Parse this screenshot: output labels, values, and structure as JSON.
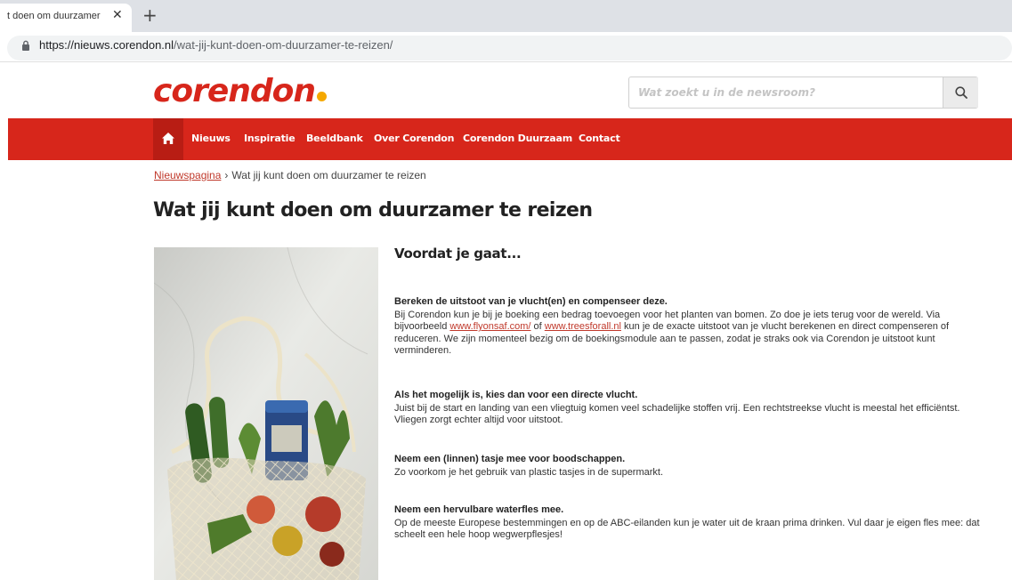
{
  "browser": {
    "tab_title": "t doen om duurzamer",
    "close_symbol": "✕",
    "new_tab_symbol": "+",
    "url_host": "https://nieuws.corendon.nl",
    "url_path": "/wat-jij-kunt-doen-om-duurzamer-te-reizen/"
  },
  "site": {
    "logo_text": "corendon",
    "brand_color": "#d7261b",
    "dot_color": "#f5a800",
    "search_placeholder": "Wat zoekt u in de newsroom?"
  },
  "nav": {
    "items": [
      "Nieuws",
      "Inspiratie",
      "Beeldbank",
      "Over Corendon",
      "Corendon Duurzaam",
      "Contact"
    ]
  },
  "breadcrumb": {
    "home": "Nieuwspagina",
    "separator": "›",
    "current": "Wat jij kunt doen om duurzamer te reizen"
  },
  "page": {
    "title": "Wat jij kunt doen om duurzamer te reizen",
    "section_title": "Voordat je gaat..."
  },
  "article": {
    "b1_heading": "Bereken de uitstoot van je vlucht(en) en compenseer deze.",
    "b1_text1": "Bij Corendon kun je bij je boeking een bedrag toevoegen voor het planten van bomen. Zo doe je iets terug voor de wereld. Via bijvoorbeeld ",
    "b1_link1": "www.flyonsaf.com/",
    "b1_text2": " of ",
    "b1_link2": "www.treesforall.nl",
    "b1_text3": " kun je de exacte uitstoot van je vlucht berekenen en direct compenseren of reduceren. We zijn momenteel bezig om de boekingsmodule aan te passen, zodat je straks ook via Corendon je uitstoot kunt verminderen.",
    "b2_heading": "Als het mogelijk is, kies dan voor een directe vlucht.",
    "b2_text": "Juist bij de start en landing van een vliegtuig komen veel schadelijke stoffen vrij. Een rechtstreekse vlucht is meestal het efficiëntst. Vliegen zorgt echter altijd voor uitstoot.",
    "b3_heading": "Neem een (linnen) tasje mee voor boodschappen.",
    "b3_text": "Zo voorkom je het gebruik van plastic tasjes in de supermarkt.",
    "b4_heading": "Neem een hervulbare waterfles mee.",
    "b4_text": "Op de meeste Europese bestemmingen en op de ABC-eilanden kun je water uit de kraan prima drinken. Vul daar je eigen fles mee: dat scheelt een hele hoop wegwerpflesjes!"
  }
}
